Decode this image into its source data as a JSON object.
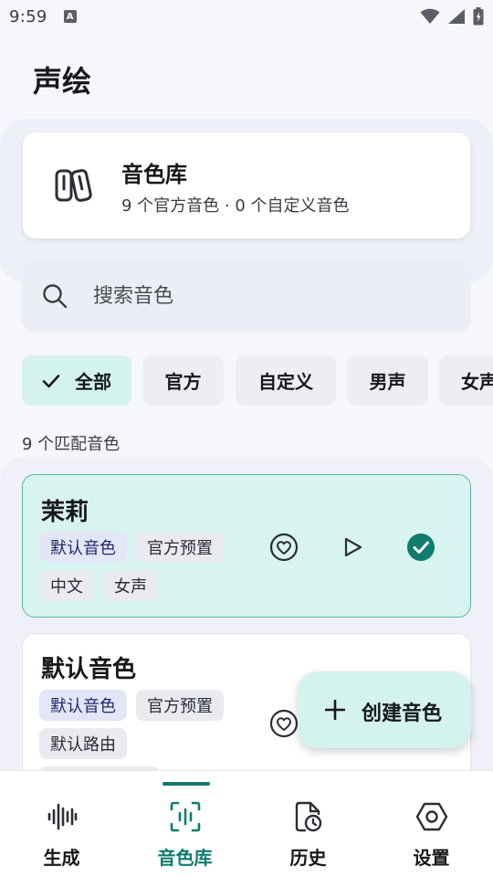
{
  "status_bar": {
    "time": "9:59",
    "notification_badge": "A"
  },
  "app": {
    "title": "声绘"
  },
  "library_card": {
    "title": "音色库",
    "subtitle": "9 个官方音色 · 0 个自定义音色",
    "icon": "books-icon"
  },
  "search": {
    "placeholder": "搜索音色",
    "value": ""
  },
  "filters": {
    "items": [
      {
        "label": "全部",
        "active": true
      },
      {
        "label": "官方",
        "active": false
      },
      {
        "label": "自定义",
        "active": false
      },
      {
        "label": "男声",
        "active": false
      },
      {
        "label": "女声",
        "active": false
      }
    ]
  },
  "match_count": "9 个匹配音色",
  "voices": [
    {
      "name": "茉莉",
      "selected": true,
      "tags": [
        "默认音色",
        "官方预置",
        "中文",
        "女声"
      ]
    },
    {
      "name": "默认音色",
      "selected": false,
      "tags": [
        "默认音色",
        "官方预置",
        "默认路由"
      ]
    }
  ],
  "fab": {
    "label": "创建音色",
    "icon": "plus-icon"
  },
  "bottom_nav": {
    "items": [
      {
        "label": "生成",
        "icon": "waveform-icon",
        "active": false
      },
      {
        "label": "音色库",
        "icon": "voice-library-icon",
        "active": true
      },
      {
        "label": "历史",
        "icon": "history-icon",
        "active": false
      },
      {
        "label": "设置",
        "icon": "settings-icon",
        "active": false
      }
    ]
  },
  "colors": {
    "accent": "#0f7c6e",
    "accent_light": "#d5f3ee",
    "selected_card": "#d8f4ef",
    "tag_primary_text": "#1d2a6b"
  }
}
